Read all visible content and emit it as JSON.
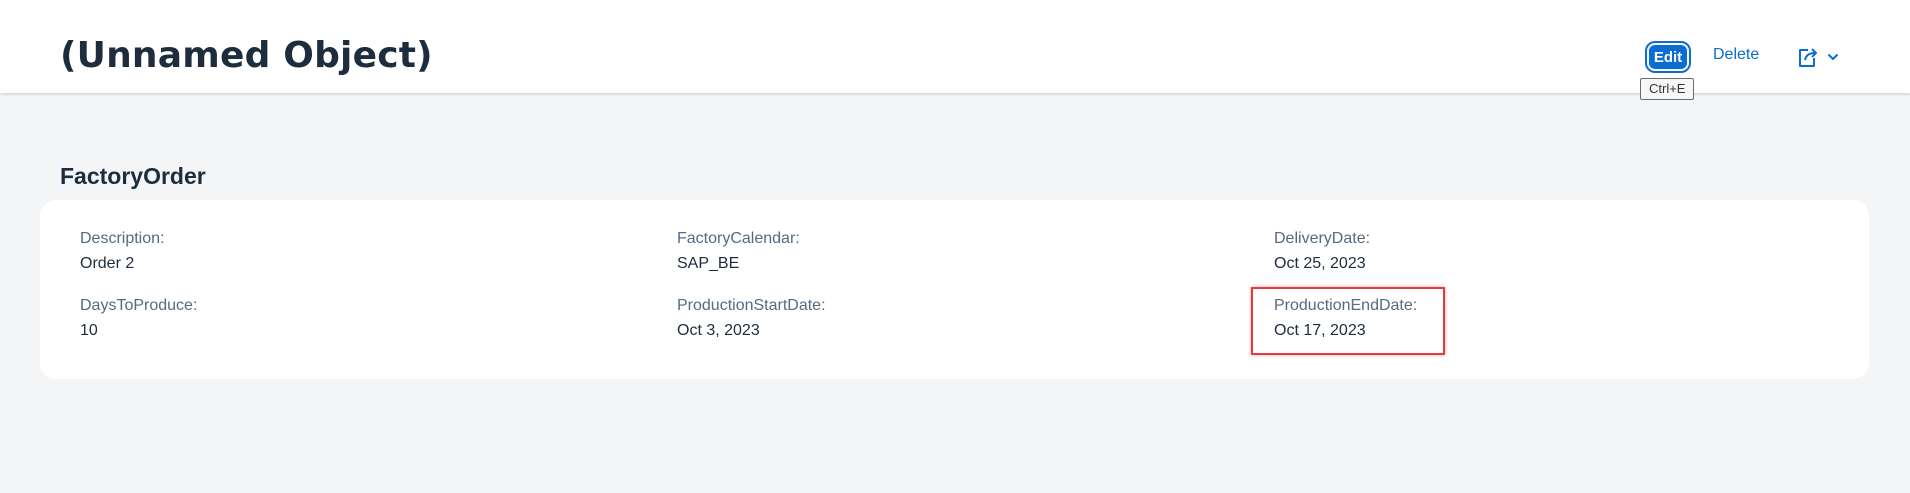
{
  "header": {
    "title": "(Unnamed Object)"
  },
  "toolbar": {
    "edit_label": "Edit",
    "delete_label": "Delete",
    "share_icon": "share-icon",
    "dropdown_icon": "chevron-down-icon",
    "edit_tooltip": "Ctrl+E"
  },
  "section": {
    "title": "FactoryOrder"
  },
  "fields": {
    "description": {
      "label": "Description:",
      "value": "Order 2"
    },
    "factory_calendar": {
      "label": "FactoryCalendar:",
      "value": "SAP_BE"
    },
    "delivery_date": {
      "label": "DeliveryDate:",
      "value": "Oct 25, 2023"
    },
    "days_to_produce": {
      "label": "DaysToProduce:",
      "value": "10"
    },
    "production_start_date": {
      "label": "ProductionStartDate:",
      "value": "Oct 3, 2023"
    },
    "production_end_date": {
      "label": "ProductionEndDate:",
      "value": "Oct 17, 2023"
    }
  },
  "colors": {
    "accent": "#0a6ed1",
    "highlight": "#e03e3e",
    "background": "#f4f5f6",
    "text": "#1d2d3e",
    "label": "#556b82"
  }
}
